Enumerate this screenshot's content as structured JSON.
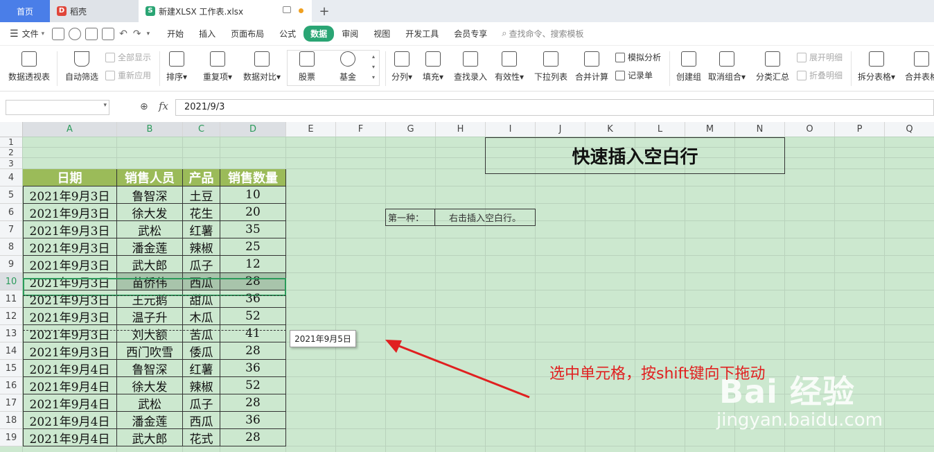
{
  "tabs": {
    "home": "首页",
    "daoke": "稻壳",
    "file": "新建XLSX 工作表.xlsx",
    "add": "+"
  },
  "menu": {
    "file": "文件",
    "items": [
      "开始",
      "插入",
      "页面布局",
      "公式",
      "数据",
      "审阅",
      "视图",
      "开发工具",
      "会员专享"
    ],
    "active": "数据",
    "search": "查找命令、搜索模板"
  },
  "ribbon": {
    "pivot": "数据透视表",
    "autofilter": "自动筛选",
    "show_all": "全部显示",
    "reapply": "重新应用",
    "sort": "排序",
    "duplicates": "重复项",
    "compare": "数据对比",
    "stock": "股票",
    "fund": "基金",
    "split": "分列",
    "fill": "填充",
    "lookup": "查找录入",
    "validity": "有效性",
    "dropdown": "下拉列表",
    "consolidate": "合并计算",
    "simulate": "模拟分析",
    "record": "记录单",
    "group": "创建组",
    "ungroup": "取消组合",
    "subtotal": "分类汇总",
    "expand": "展开明细",
    "collapse": "折叠明细",
    "split_table": "拆分表格",
    "merge_table": "合并表格"
  },
  "formula_bar": {
    "fx": "fx",
    "value": "2021/9/3"
  },
  "columns": [
    "A",
    "B",
    "C",
    "D",
    "E",
    "F",
    "G",
    "H",
    "I",
    "J",
    "K",
    "L",
    "M",
    "N",
    "O",
    "P",
    "Q"
  ],
  "rows": [
    "1",
    "2",
    "3",
    "4",
    "5",
    "6",
    "7",
    "8",
    "9",
    "10",
    "11",
    "12",
    "13",
    "14",
    "15",
    "16",
    "17",
    "18",
    "19"
  ],
  "table": {
    "headers": [
      "日期",
      "销售人员",
      "产品",
      "销售数量"
    ],
    "rows": [
      [
        "2021年9月3日",
        "鲁智深",
        "土豆",
        "10"
      ],
      [
        "2021年9月3日",
        "徐大发",
        "花生",
        "20"
      ],
      [
        "2021年9月3日",
        "武松",
        "红薯",
        "35"
      ],
      [
        "2021年9月3日",
        "潘金莲",
        "辣椒",
        "25"
      ],
      [
        "2021年9月3日",
        "武大郎",
        "瓜子",
        "12"
      ],
      [
        "2021年9月3日",
        "苗侨伟",
        "西瓜",
        "28"
      ],
      [
        "2021年9月3日",
        "王元鹅",
        "甜瓜",
        "36"
      ],
      [
        "2021年9月3日",
        "温子升",
        "木瓜",
        "52"
      ],
      [
        "2021年9月3日",
        "刘大额",
        "苦瓜",
        "41"
      ],
      [
        "2021年9月3日",
        "西门吹雪",
        "倭瓜",
        "28"
      ],
      [
        "2021年9月4日",
        "鲁智深",
        "红薯",
        "36"
      ],
      [
        "2021年9月4日",
        "徐大发",
        "辣椒",
        "52"
      ],
      [
        "2021年9月4日",
        "武松",
        "瓜子",
        "28"
      ],
      [
        "2021年9月4日",
        "潘金莲",
        "西瓜",
        "36"
      ],
      [
        "2021年9月4日",
        "武大郎",
        "花式",
        "28"
      ]
    ]
  },
  "title_box": "快速插入空白行",
  "method": {
    "label": "第一种：",
    "text": "右击插入空白行。"
  },
  "tooltip": "2021年9月5日",
  "annotation": "选中单元格，按shift键向下拖动",
  "watermark": {
    "logo": "Bai 经验",
    "url": "jingyan.baidu.com"
  },
  "colors": {
    "accent": "#2aa574",
    "header_fill": "#9bbb59",
    "sheet_bg": "#cce8cf",
    "annotation": "#e02020",
    "home_tab": "#4a7ee8"
  }
}
